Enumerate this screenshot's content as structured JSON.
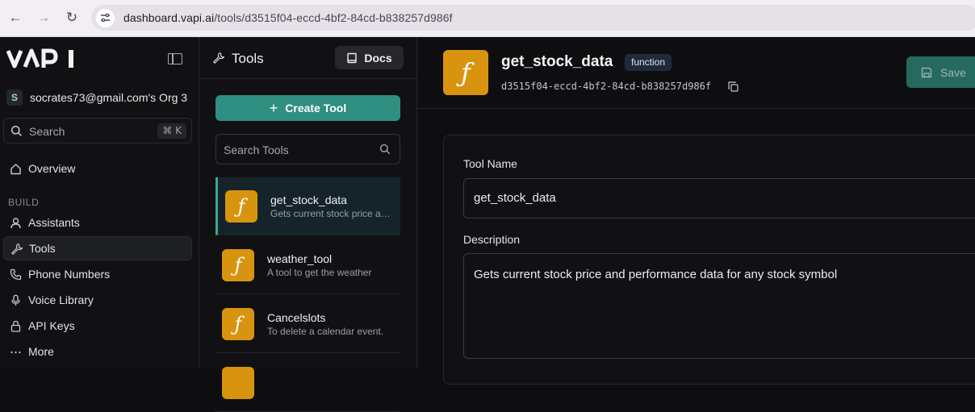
{
  "browser": {
    "url_host": "dashboard.vapi.ai",
    "url_path": "/tools/d3515f04-eccd-4bf2-84cd-b838257d986f"
  },
  "sidebar": {
    "brand": "VAPI",
    "org_initial": "S",
    "org_name": "socrates73@gmail.com's Org 3",
    "search_label": "Search",
    "search_shortcut": "⌘ K",
    "overview_label": "Overview",
    "section_build": "BUILD",
    "items": [
      {
        "label": "Assistants",
        "icon": "user-icon",
        "active": false
      },
      {
        "label": "Tools",
        "icon": "wrench-icon",
        "active": true
      },
      {
        "label": "Phone Numbers",
        "icon": "phone-icon",
        "active": false
      },
      {
        "label": "Voice Library",
        "icon": "mic-icon",
        "active": false
      },
      {
        "label": "API Keys",
        "icon": "lock-icon",
        "active": false
      },
      {
        "label": "More",
        "icon": "more-icon",
        "active": false
      }
    ]
  },
  "tools_panel": {
    "title": "Tools",
    "docs_label": "Docs",
    "create_label": "Create Tool",
    "search_placeholder": "Search Tools",
    "tools": [
      {
        "name": "get_stock_data",
        "desc": "Gets current stock price and performance data",
        "active": true
      },
      {
        "name": "weather_tool",
        "desc": "A tool to get the weather",
        "active": false
      },
      {
        "name": "Cancelslots",
        "desc": "To delete a calendar event.",
        "active": false
      }
    ],
    "tool_icon_glyph": "ƒ"
  },
  "detail": {
    "icon_glyph": "ƒ",
    "name": "get_stock_data",
    "type_badge": "function",
    "tool_id": "d3515f04-eccd-4bf2-84cd-b838257d986f",
    "save_label": "Save",
    "name_label": "Tool Name",
    "name_value": "get_stock_data",
    "description_label": "Description",
    "description_value": "Gets current stock price and performance data for any stock symbol"
  },
  "colors": {
    "accent": "#2f8f80",
    "tool_icon_bg": "#d8940f",
    "background": "#0e0e11"
  }
}
